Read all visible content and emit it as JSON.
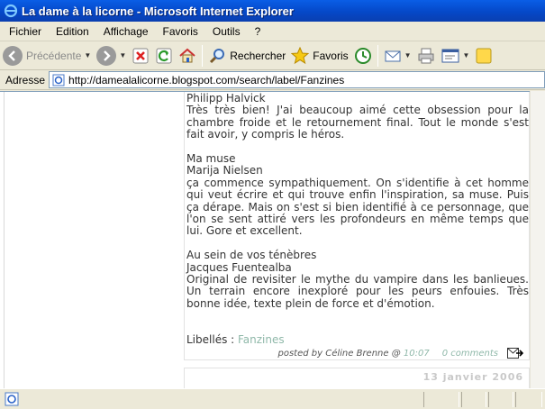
{
  "window": {
    "title": "La dame à la licorne - Microsoft Internet Explorer"
  },
  "menu": {
    "items": [
      "Fichier",
      "Edition",
      "Affichage",
      "Favoris",
      "Outils",
      "?"
    ]
  },
  "toolbar": {
    "back_label": "Précédente",
    "search_label": "Rechercher",
    "favorites_label": "Favoris"
  },
  "address": {
    "label": "Adresse",
    "url": "http://damealalicorne.blogspot.com/search/label/Fanzines"
  },
  "post": {
    "entries": [
      {
        "author": "Philipp Halvick",
        "text": "Très très bien! J'ai beaucoup aimé cette obsession pour la chambre froide et le retournement final. Tout le monde s'est fait avoir, y compris le héros."
      },
      {
        "title": "Ma muse",
        "author": "Marija Nielsen",
        "text": "ça commence sympathiquement. On s'identifie à cet homme qui veut écrire et qui trouve enfin l'inspiration, sa muse. Puis ça dérape. Mais on s'est si bien identifié à ce personnage, que l'on se sent attiré vers les profondeurs en même temps que lui. Gore et excellent."
      },
      {
        "title": "Au sein de vos ténèbres",
        "author": "Jacques Fuentealba",
        "text": "Original de revisiter le mythe du vampire dans les banlieues. Un terrain encore inexploré pour les peurs enfouies. Très bonne idée, texte plein de force et d'émotion."
      }
    ],
    "labels_prefix": "Libellés : ",
    "label": "Fanzines",
    "posted_by": "posted by Céline Brenne @",
    "time": "10:07",
    "comments": "0 comments"
  },
  "next_post": {
    "date": "13 janvier 2006"
  },
  "colors": {
    "titlebar": "#0548c8",
    "link": "#8fb8a9",
    "body_text": "#333333"
  }
}
